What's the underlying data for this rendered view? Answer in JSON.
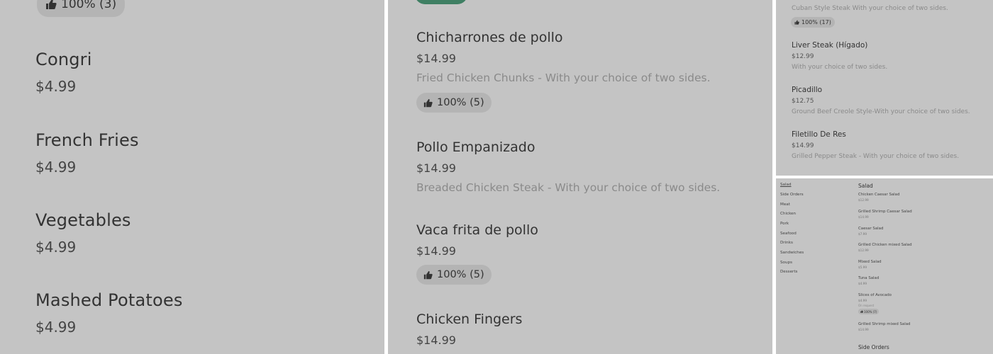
{
  "panel1": {
    "top_badge": "100% (3)",
    "items": [
      {
        "name": "Congri",
        "price": "$4.99"
      },
      {
        "name": "French Fries",
        "price": "$4.99"
      },
      {
        "name": "Vegetables",
        "price": "$4.99"
      },
      {
        "name": "Mashed Potatoes",
        "price": "$4.99"
      }
    ]
  },
  "panel2": {
    "items": [
      {
        "name": "Chicharrones de pollo",
        "price": "$14.99",
        "description": "Fried Chicken Chunks - With your choice of two sides.",
        "rating": "100% (5)"
      },
      {
        "name": "Pollo Empanizado",
        "price": "$14.99",
        "description": "Breaded Chicken Steak - With your choice of two sides."
      },
      {
        "name": "Vaca frita de pollo",
        "price": "$14.99",
        "rating": "100% (5)"
      },
      {
        "name": "Chicken Fingers",
        "price": "$14.99"
      }
    ]
  },
  "panel3": {
    "top_desc": "Cuban Style Steak With your choice of two sides.",
    "top_rating": "100% (17)",
    "items": [
      {
        "name": "Liver Steak (Hígado)",
        "price": "$12.99",
        "description": "With your choice of two sides."
      },
      {
        "name": "Picadillo",
        "price": "$12.75",
        "description": "Ground Beef Creole Style-With your choice of two sides."
      },
      {
        "name": "Filetillo De Res",
        "price": "$14.99",
        "description": "Grilled Pepper Steak - With your choice of two sides."
      }
    ]
  },
  "panel4": {
    "nav": [
      "Salad",
      "Side Orders",
      "Meat",
      "Chicken",
      "Pork",
      "Seafood",
      "Drinks",
      "Sandwiches",
      "Soups",
      "Desserts"
    ],
    "section_title": "Salad",
    "items": [
      {
        "name": "Chicken Caesar Salad",
        "price": "$12.99"
      },
      {
        "name": "Grilled Shrimp Caesar Salad",
        "price": "$14.99"
      },
      {
        "name": "Caesar Salad",
        "price": "$7.99"
      },
      {
        "name": "Grilled Chicken mixed Salad",
        "price": "$12.99"
      },
      {
        "name": "Mixed Salad",
        "price": "$5.99"
      },
      {
        "name": "Tuna Salad",
        "price": "$4.99"
      },
      {
        "name": "Slices of Avocado",
        "price": "$4.99",
        "note": "On request",
        "rating": "100% (7)"
      },
      {
        "name": "Grilled Shrimp mixed Salad",
        "price": "$14.99"
      }
    ],
    "next_section_title": "Side Orders"
  },
  "colors": {
    "panel_bg": "#c4c4c4",
    "badge_bg": "#b4b4b4",
    "accent_green": "#3f7f63"
  }
}
